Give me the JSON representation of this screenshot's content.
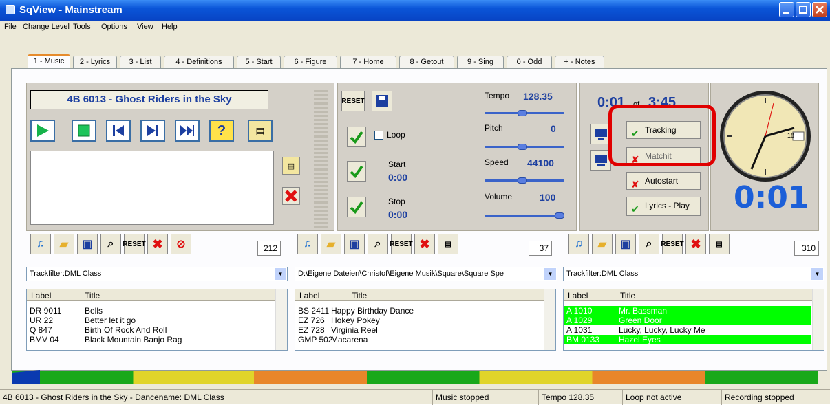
{
  "window": {
    "title": "SqView - Mainstream"
  },
  "menu": [
    "File",
    "Change Level",
    "Tools",
    "Options",
    "View",
    "Help"
  ],
  "tabs": [
    "1 - Music",
    "2 - Lyrics",
    "3 - List",
    "4 - Definitions",
    "5 - Start",
    "6 - Figure",
    "7 - Home",
    "8 - Getout",
    "9 - Sing",
    "0 - Odd",
    "+ - Notes"
  ],
  "player": {
    "now_playing": "4B 6013 - Ghost Riders in the Sky"
  },
  "controls": {
    "reset_label": "RESET",
    "loop_label": "Loop",
    "start_label": "Start",
    "start_value": "0:00",
    "stop_label": "Stop",
    "stop_value": "0:00",
    "tempo_label": "Tempo",
    "tempo_value": "128.35",
    "pitch_label": "Pitch",
    "pitch_value": "0",
    "speed_label": "Speed",
    "speed_value": "44100",
    "volume_label": "Volume",
    "volume_value": "100"
  },
  "time": {
    "elapsed": "0:01",
    "of": "of",
    "total": "3:45",
    "big": "0:01",
    "clock_day": "18"
  },
  "toggles": {
    "tracking": "Tracking",
    "match": "Matchit",
    "autostart": "Autostart",
    "lyrics": "Lyrics - Play"
  },
  "lists": [
    {
      "count": "212",
      "filter": "Trackfilter:DML Class",
      "headers": [
        "Label",
        "Title"
      ],
      "rows": [
        [
          "DR 9011",
          "Bells"
        ],
        [
          "UR 22",
          "Better let it go"
        ],
        [
          "Q 847",
          "Birth Of Rock And Roll"
        ],
        [
          "BMV 04",
          "Black Mountain Banjo Rag"
        ]
      ]
    },
    {
      "count": "37",
      "filter": "D:\\Eigene Dateien\\Christof\\Eigene Musik\\Square\\Square Spe",
      "headers": [
        "Label",
        "Title"
      ],
      "rows": [
        [
          "BS 2411",
          "Happy Birthday Dance"
        ],
        [
          "EZ 726",
          "Hokey Pokey"
        ],
        [
          "EZ 728",
          "Virginia Reel"
        ],
        [
          "GMP 502",
          "Macarena"
        ]
      ]
    },
    {
      "count": "310",
      "filter": "Trackfilter:DML Class",
      "headers": [
        "Label",
        "Title"
      ],
      "rows": [
        [
          "A 1010",
          "Mr. Bassman"
        ],
        [
          "A 1029",
          "Green Door"
        ],
        [
          "A 1031",
          "Lucky, Lucky, Lucky Me"
        ],
        [
          "BM 0133",
          "Hazel Eyes"
        ]
      ]
    }
  ],
  "status": {
    "song": "4B 6013 - Ghost Riders in the Sky - Dancename: DML Class",
    "music": "Music stopped",
    "tempo": "Tempo 128.35",
    "loop": "Loop not active",
    "recording": "Recording stopped"
  }
}
